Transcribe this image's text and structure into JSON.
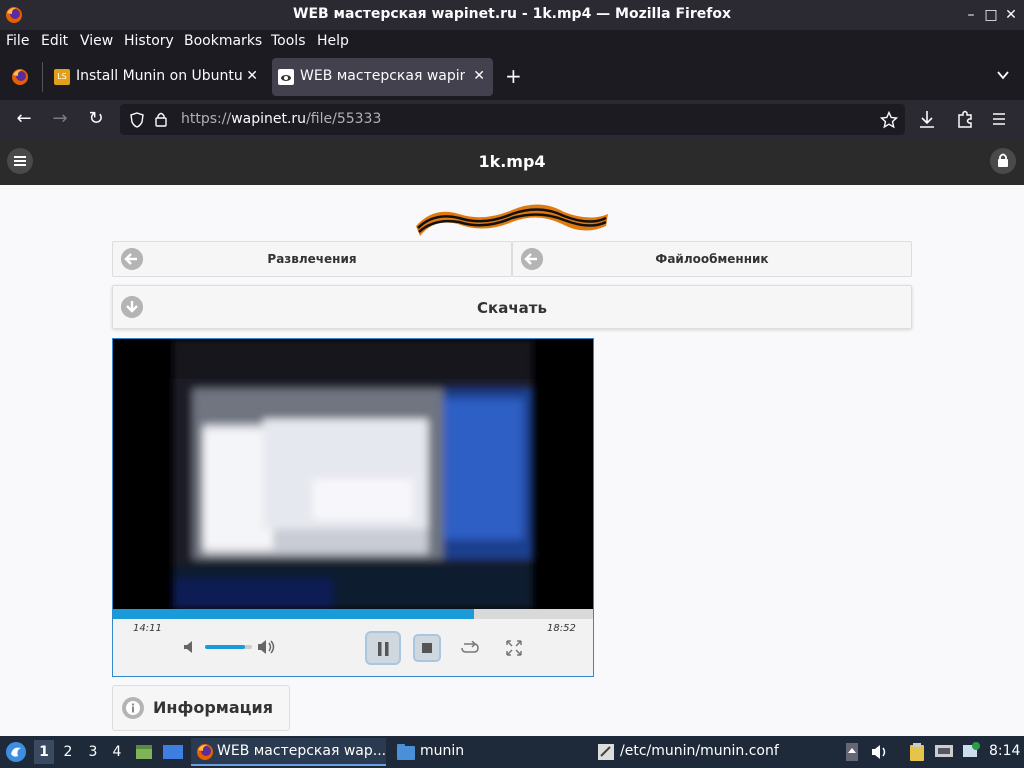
{
  "window": {
    "title": "WEB мастерская wapinet.ru - 1k.mp4 — Mozilla Firefox"
  },
  "menu": {
    "items": [
      "File",
      "Edit",
      "View",
      "History",
      "Bookmarks",
      "Tools",
      "Help"
    ]
  },
  "tabs": [
    {
      "title": "Install Munin on Ubuntu :",
      "active": false
    },
    {
      "title": "WEB мастерская wapinet",
      "active": true
    }
  ],
  "nav": {
    "url_scheme": "https://",
    "url_host": "wapinet.ru",
    "url_path": "/file/55333"
  },
  "page": {
    "header_title": "1k.mp4",
    "nav_left": "Развлечения",
    "nav_right": "Файлообменник",
    "download": "Скачать",
    "info": "Информация"
  },
  "player": {
    "current_time": "14:11",
    "duration": "18:52",
    "progress_fraction": 0.752,
    "volume_fraction": 0.85,
    "state": "playing"
  },
  "taskbar": {
    "workspaces": [
      "1",
      "2",
      "3",
      "4"
    ],
    "active_workspace": "1",
    "windows": [
      {
        "title": "WEB мастерская wap...",
        "active": true
      },
      {
        "title": "munin",
        "active": false
      },
      {
        "title": "/etc/munin/munin.conf",
        "active": false
      }
    ],
    "clock": "8:14"
  },
  "colors": {
    "accent_blue": "#1a9ad9",
    "toolbar_dark": "#2b2a33",
    "page_header": "#2b2b2b"
  }
}
